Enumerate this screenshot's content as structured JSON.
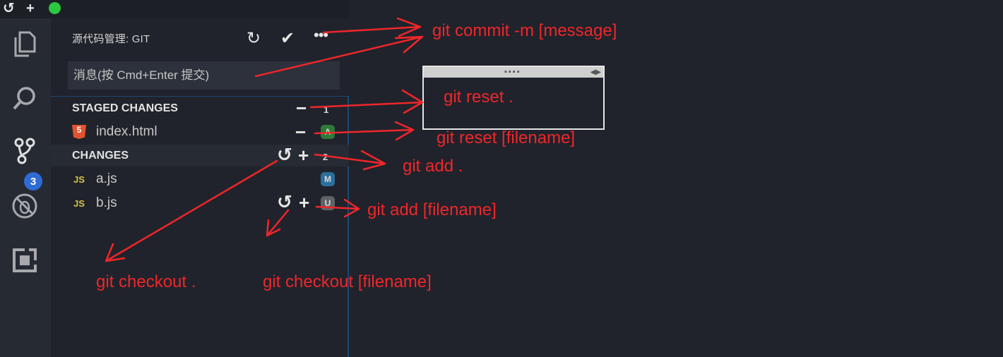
{
  "title_bar": {
    "undo_icon": "undo-icon",
    "add_icon": "plus-icon",
    "status_color": "#2bc840"
  },
  "activity_bar": {
    "items": [
      {
        "icon": "explorer-icon"
      },
      {
        "icon": "search-icon"
      },
      {
        "icon": "source-control-icon",
        "badge": "3"
      },
      {
        "icon": "debug-icon"
      },
      {
        "icon": "extensions-icon"
      }
    ]
  },
  "scm": {
    "title": "源代码管理: GIT",
    "header_actions": [
      "refresh-icon",
      "commit-check-icon",
      "more-icon"
    ],
    "message_placeholder": "消息(按 Cmd+Enter 提交)",
    "staged": {
      "label": "STAGED CHANGES",
      "count": "1",
      "files": [
        {
          "name": "index.html",
          "icon": "html5-icon",
          "status": "A",
          "status_color": "#2f7a3a"
        }
      ]
    },
    "changes": {
      "label": "CHANGES",
      "count": "2",
      "files": [
        {
          "name": "a.js",
          "icon_text": "JS",
          "status": "M",
          "status_color": "#2a6f9c"
        },
        {
          "name": "b.js",
          "icon_text": "JS",
          "status": "U",
          "status_color": "#5f6366"
        }
      ]
    }
  },
  "annotations": {
    "commit": "git commit -m [message]",
    "reset_all": "git reset .",
    "reset_file": "git reset  [filename]",
    "add_all": "git add .",
    "add_file": "git add [filename]",
    "checkout_all": "git checkout .",
    "checkout_file": "git checkout [filename]",
    "color": "#f0262a"
  }
}
